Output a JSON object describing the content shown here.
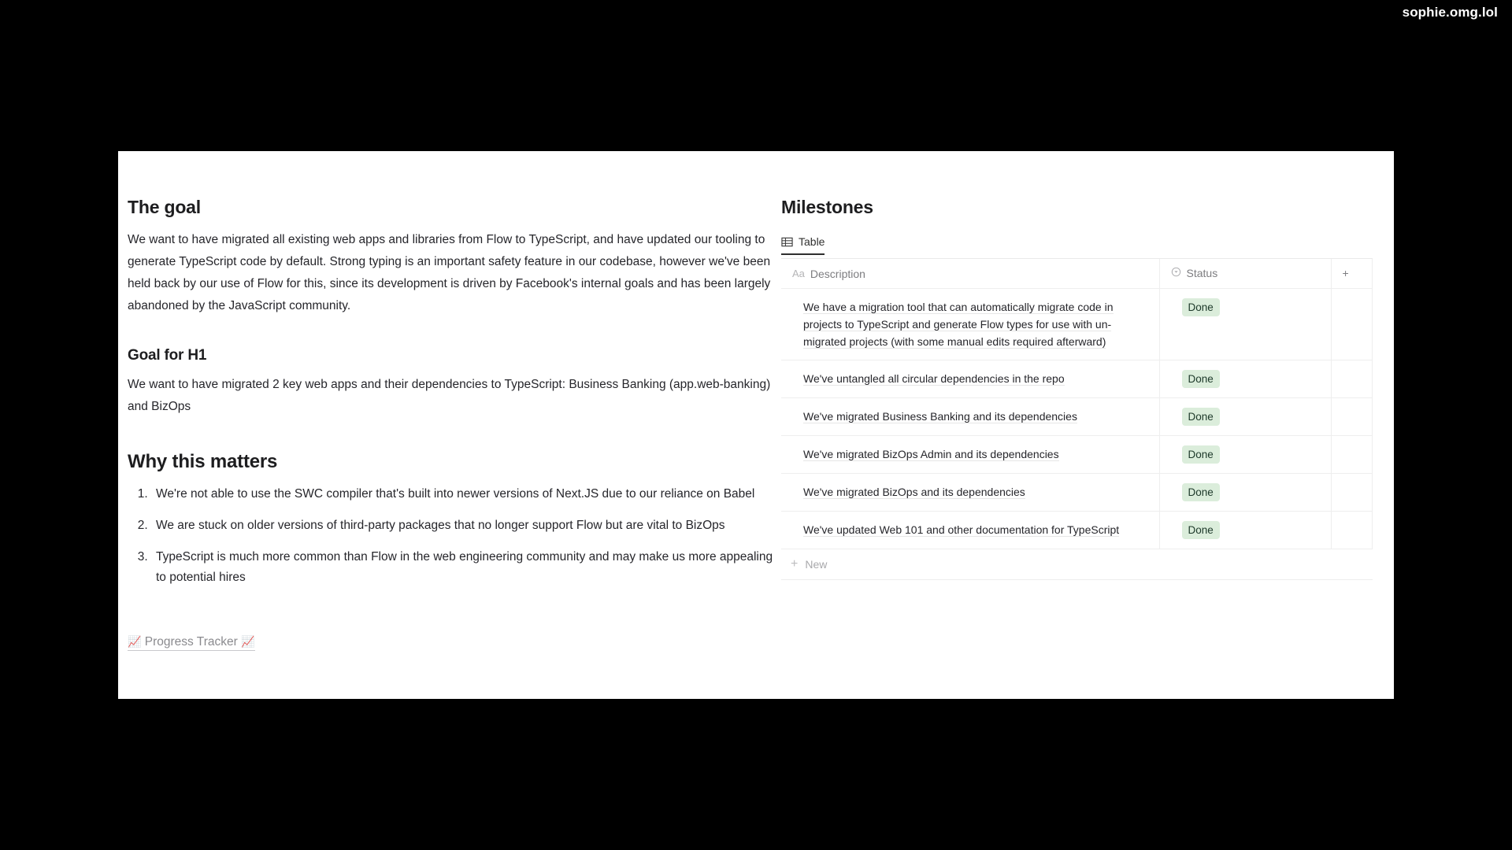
{
  "watermark": "sophie.omg.lol",
  "document": {
    "heading": "The goal",
    "goal_paragraph": "We want to have migrated all existing web apps and libraries from Flow to TypeScript, and have updated our tooling to generate TypeScript code by default. Strong typing is an important safety feature in our codebase, however we've been held back by our use of Flow for this, since its development is driven by Facebook's internal goals and has been largely abandoned by the JavaScript community.",
    "h1_heading": "Goal for H1",
    "h1_paragraph": "We want to have migrated 2 key web apps and their dependencies to TypeScript: Business Banking (app.web-banking) and BizOps",
    "why_heading": "Why this matters",
    "reasons": [
      "We're not able to use the SWC compiler that's built into newer versions of Next.JS due to our reliance on Babel",
      "We are stuck on older versions of third-party packages that no longer support Flow but are vital to BizOps",
      "TypeScript is much more common than Flow in the web engineering community and may make us more appealing to potential hires"
    ],
    "tracker_link": {
      "emoji_left": "📈",
      "label": "Progress Tracker",
      "emoji_right": "📈"
    }
  },
  "milestones": {
    "title": "Milestones",
    "tab": {
      "label": "Table",
      "icon": "table-icon",
      "active": true
    },
    "columns": [
      {
        "label": "Description",
        "type_icon": "Aa"
      },
      {
        "label": "Status",
        "type_icon": "select-icon"
      }
    ],
    "add_column_label": "+",
    "rows": [
      {
        "description": "We have a migration tool that can automatically migrate code in projects to TypeScript and generate Flow types for use with un-migrated projects (with some manual edits required afterward)",
        "status": "Done"
      },
      {
        "description": "We've untangled all circular dependencies in the repo",
        "status": "Done"
      },
      {
        "description": "We've migrated Business Banking and its dependencies",
        "status": "Done"
      },
      {
        "description": "We've migrated BizOps Admin and its dependencies",
        "status": "Done"
      },
      {
        "description": "We've migrated BizOps and its dependencies",
        "status": "Done"
      },
      {
        "description": "We've updated Web 101 and other documentation for TypeScript",
        "status": "Done"
      }
    ],
    "new_row_label": "New",
    "status_badge_color": "#dbeddb"
  }
}
